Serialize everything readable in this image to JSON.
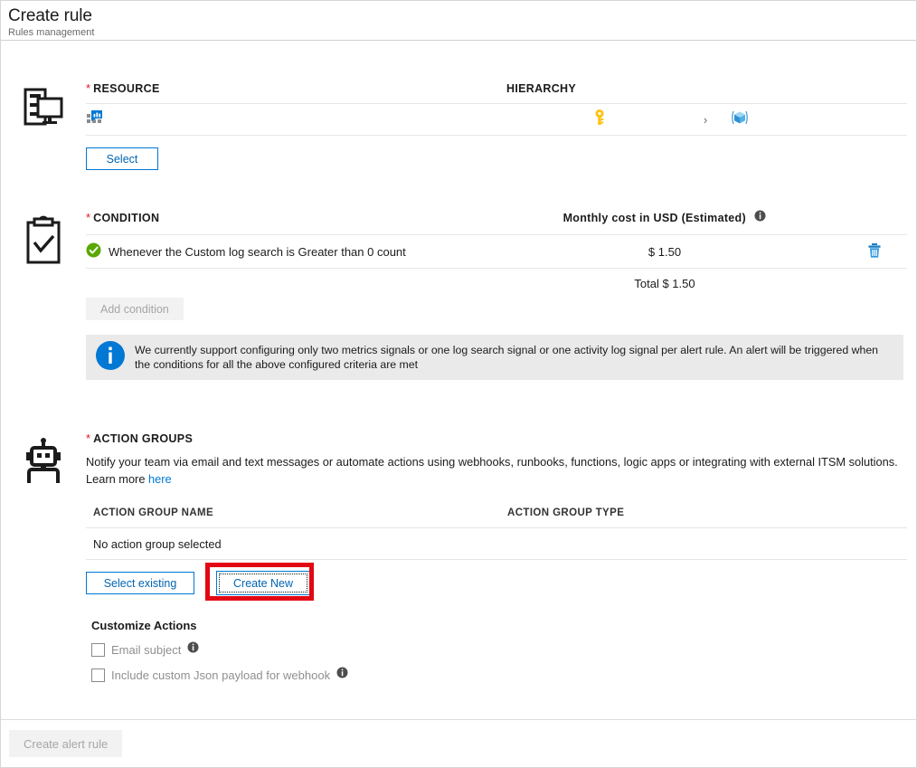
{
  "header": {
    "title": "Create rule",
    "subtitle": "Rules management"
  },
  "resource": {
    "icon": "server-monitor-icon",
    "label": "RESOURCE",
    "required_mark": "*",
    "hierarchy_header": "HIERARCHY",
    "row": {
      "resource_icon": "log-analytics-workspace-icon",
      "subscription_icon": "key-icon",
      "separator_icon": "chevron-right-icon",
      "resource_group_icon": "resource-group-cube-icon"
    },
    "select_button": "Select"
  },
  "condition": {
    "icon": "clipboard-check-icon",
    "label": "CONDITION",
    "required_mark": "*",
    "cost_header": "Monthly cost in USD (Estimated)",
    "rows": [
      {
        "status_icon": "green-check-icon",
        "text": "Whenever the Custom log search is Greater than 0 count",
        "cost": "$ 1.50",
        "delete_icon": "trash-icon"
      }
    ],
    "total_label": "Total",
    "total_value": "$ 1.50",
    "add_condition_button": "Add condition",
    "info_banner": {
      "icon": "info-circle-icon",
      "text": "We currently support configuring only two metrics signals or one log search signal or one activity log signal per alert rule. An alert will be triggered when the conditions for all the above configured criteria are met"
    }
  },
  "action_groups": {
    "icon": "robot-icon",
    "label": "ACTION GROUPS",
    "required_mark": "*",
    "description": "Notify your team via email and text messages or automate actions using webhooks, runbooks, functions, logic apps or integrating with external ITSM solutions. Learn more",
    "learn_more_link": "here",
    "table": {
      "columns": [
        "ACTION GROUP NAME",
        "ACTION GROUP TYPE"
      ],
      "empty_text": "No action group selected"
    },
    "select_existing_button": "Select existing",
    "create_new_button": "Create New",
    "customize_actions_title": "Customize Actions",
    "checkboxes": [
      {
        "label": "Email subject",
        "checked": false,
        "info_icon": "info-circle-icon"
      },
      {
        "label": "Include custom Json payload for webhook",
        "checked": false,
        "info_icon": "info-circle-icon"
      }
    ]
  },
  "footer": {
    "create_alert_rule_button": "Create alert rule"
  },
  "colors": {
    "accent_blue": "#0078d4",
    "required_red": "#e81123",
    "highlight_red": "#e30613",
    "success_green": "#5aa700",
    "key_yellow": "#ffc20e",
    "disabled_gray": "#a6a6a6"
  }
}
